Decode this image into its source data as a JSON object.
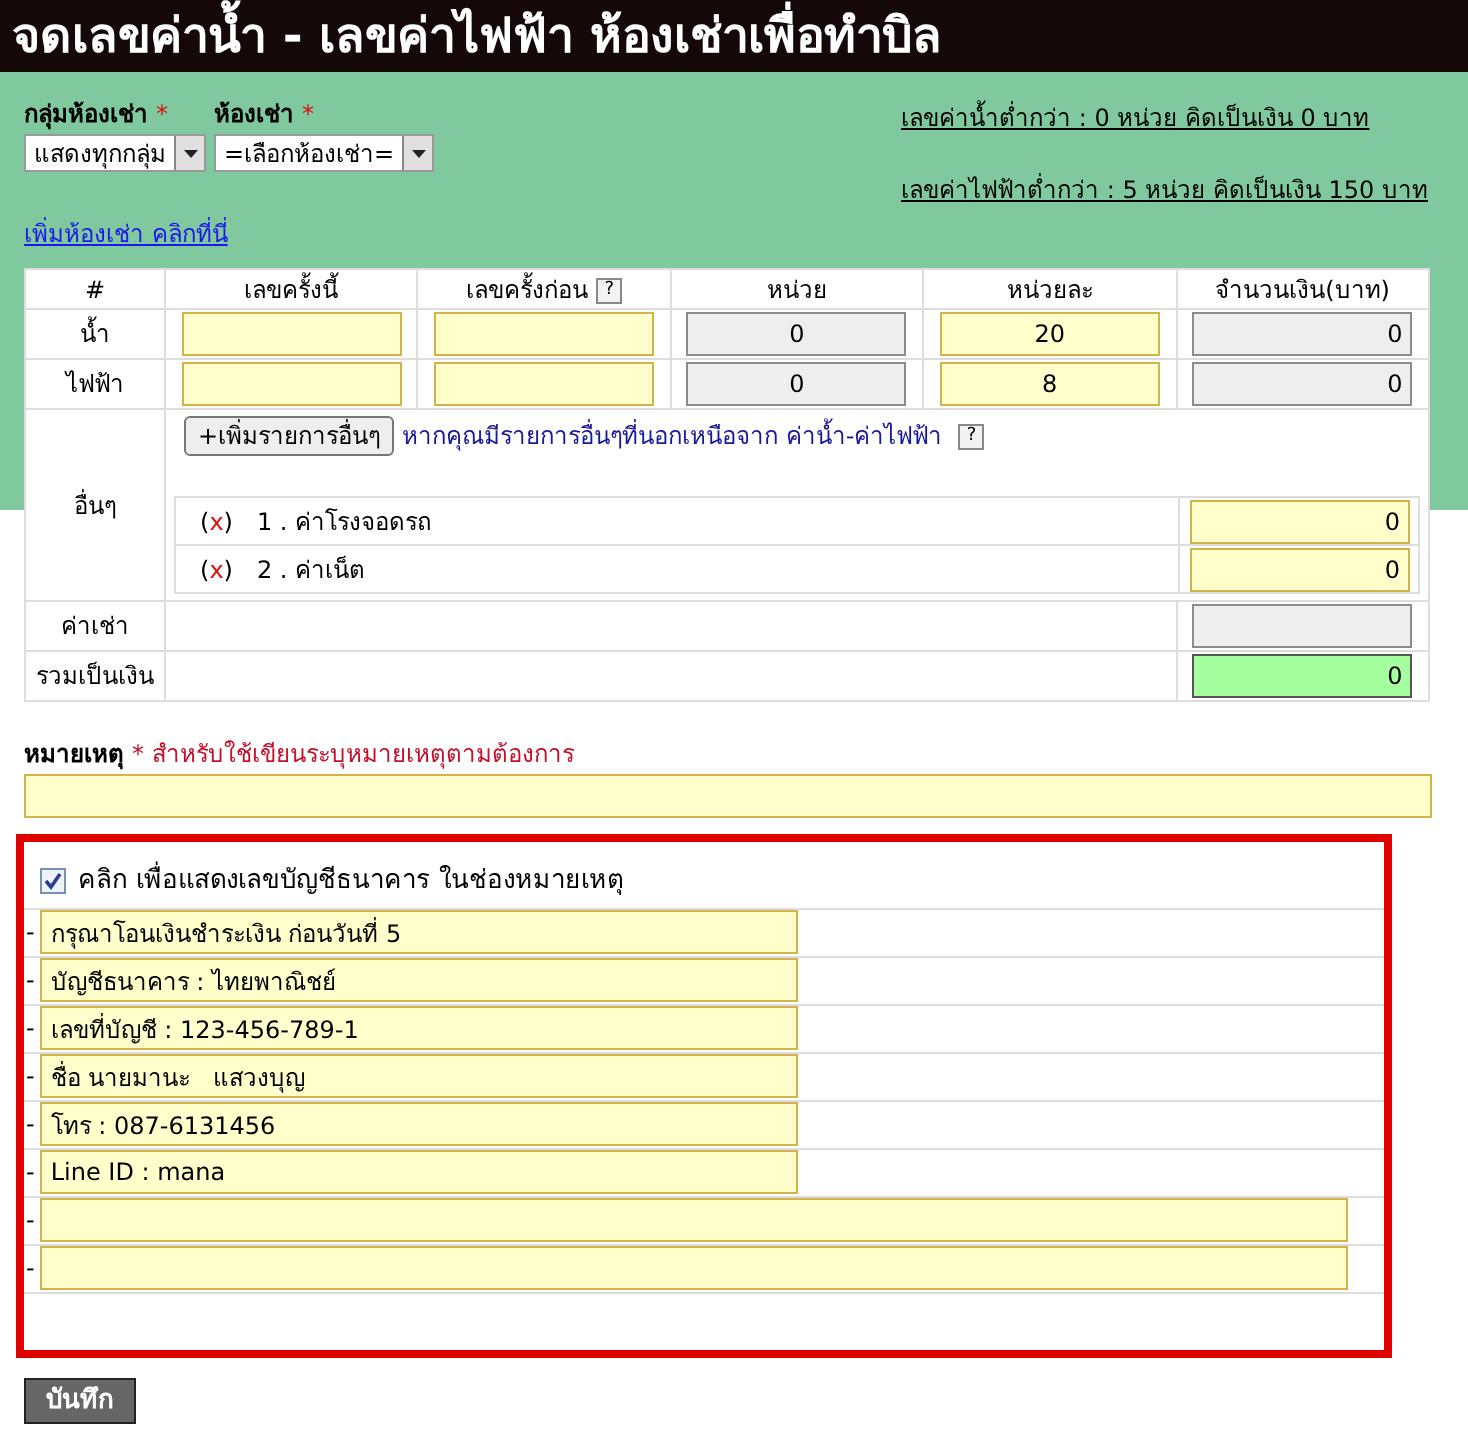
{
  "title": "จดเลขค่าน้ำ - เลขค่าไฟฟ้า ห้องเช่าเพื่อทำบิล",
  "filters": [
    {
      "label": "กลุ่มห้องเช่า",
      "required_mark": "*",
      "value": "แสดงทุกกลุ่ม"
    },
    {
      "label": "ห้องเช่า",
      "required_mark": "*",
      "value": "=เลือกห้องเช่า="
    }
  ],
  "info_lines": [
    "เลขค่าน้ำต่ำกว่า : 0 หน่วย คิดเป็นเงิน 0 บาท",
    "เลขค่าไฟฟ้าต่ำกว่า : 5 หน่วย คิดเป็นเงิน 150 บาท"
  ],
  "add_room_link": "เพิ่มห้องเช่า คลิกที่นี่",
  "table": {
    "columns": [
      {
        "label": "#"
      },
      {
        "label": "เลขครั้งนี้"
      },
      {
        "label": "เลขครั้งก่อน",
        "help": "?"
      },
      {
        "label": "หน่วย"
      },
      {
        "label": "หน่วยละ"
      },
      {
        "label": "จำนวนเงิน(บาท)"
      }
    ],
    "meter_rows": [
      {
        "label": "น้ำ",
        "units": "0",
        "rate": "20",
        "amount": "0"
      },
      {
        "label": "ไฟฟ้า",
        "units": "0",
        "rate": "8",
        "amount": "0"
      }
    ],
    "other": {
      "label": "อื่นๆ",
      "add_button": "+เพิ่มรายการอื่นๆ",
      "hint": "หากคุณมีรายการอื่นๆที่นอกเหนือจาก ค่าน้ำ-ค่าไฟฟ้า",
      "help": "?",
      "items": [
        {
          "remove": [
            "(",
            "x",
            ")"
          ],
          "label": "1 . ค่าโรงจอดรถ",
          "value": "0"
        },
        {
          "remove": [
            "(",
            "x",
            ")"
          ],
          "label": "2 . ค่าเน็ต",
          "value": "0"
        }
      ]
    },
    "rent": {
      "label": "ค่าเช่า"
    },
    "total": {
      "label": "รวมเป็นเงิน",
      "value": "0"
    }
  },
  "note": {
    "label": "หมายเหตุ",
    "required_mark": "*",
    "hint": "สำหรับใช้เขียนระบุหมายเหตุตามต้องการ"
  },
  "bank": {
    "checked": true,
    "label": "คลิก เพื่อแสดงเลขบัญชีธนาคาร ในช่องหมายเหตุ",
    "lines": [
      {
        "bullet": "-",
        "kind": "short",
        "value": "กรุณาโอนเงินชำระเงิน ก่อนวันที่ 5"
      },
      {
        "bullet": "-",
        "kind": "short",
        "value": "บัญชีธนาคาร : ไทยพาณิชย์"
      },
      {
        "bullet": "-",
        "kind": "short",
        "value": "เลขที่บัญชี : 123-456-789-1"
      },
      {
        "bullet": "-",
        "kind": "short",
        "value": "ชื่อ นายมานะ   แสวงบุญ"
      },
      {
        "bullet": "-",
        "kind": "short",
        "value": "โทร : 087-6131456"
      },
      {
        "bullet": "-",
        "kind": "short",
        "value": "Line ID : mana"
      },
      {
        "bullet": "-",
        "kind": "wide"
      },
      {
        "bullet": "-",
        "kind": "wide"
      }
    ]
  },
  "save_button": "บันทึก"
}
